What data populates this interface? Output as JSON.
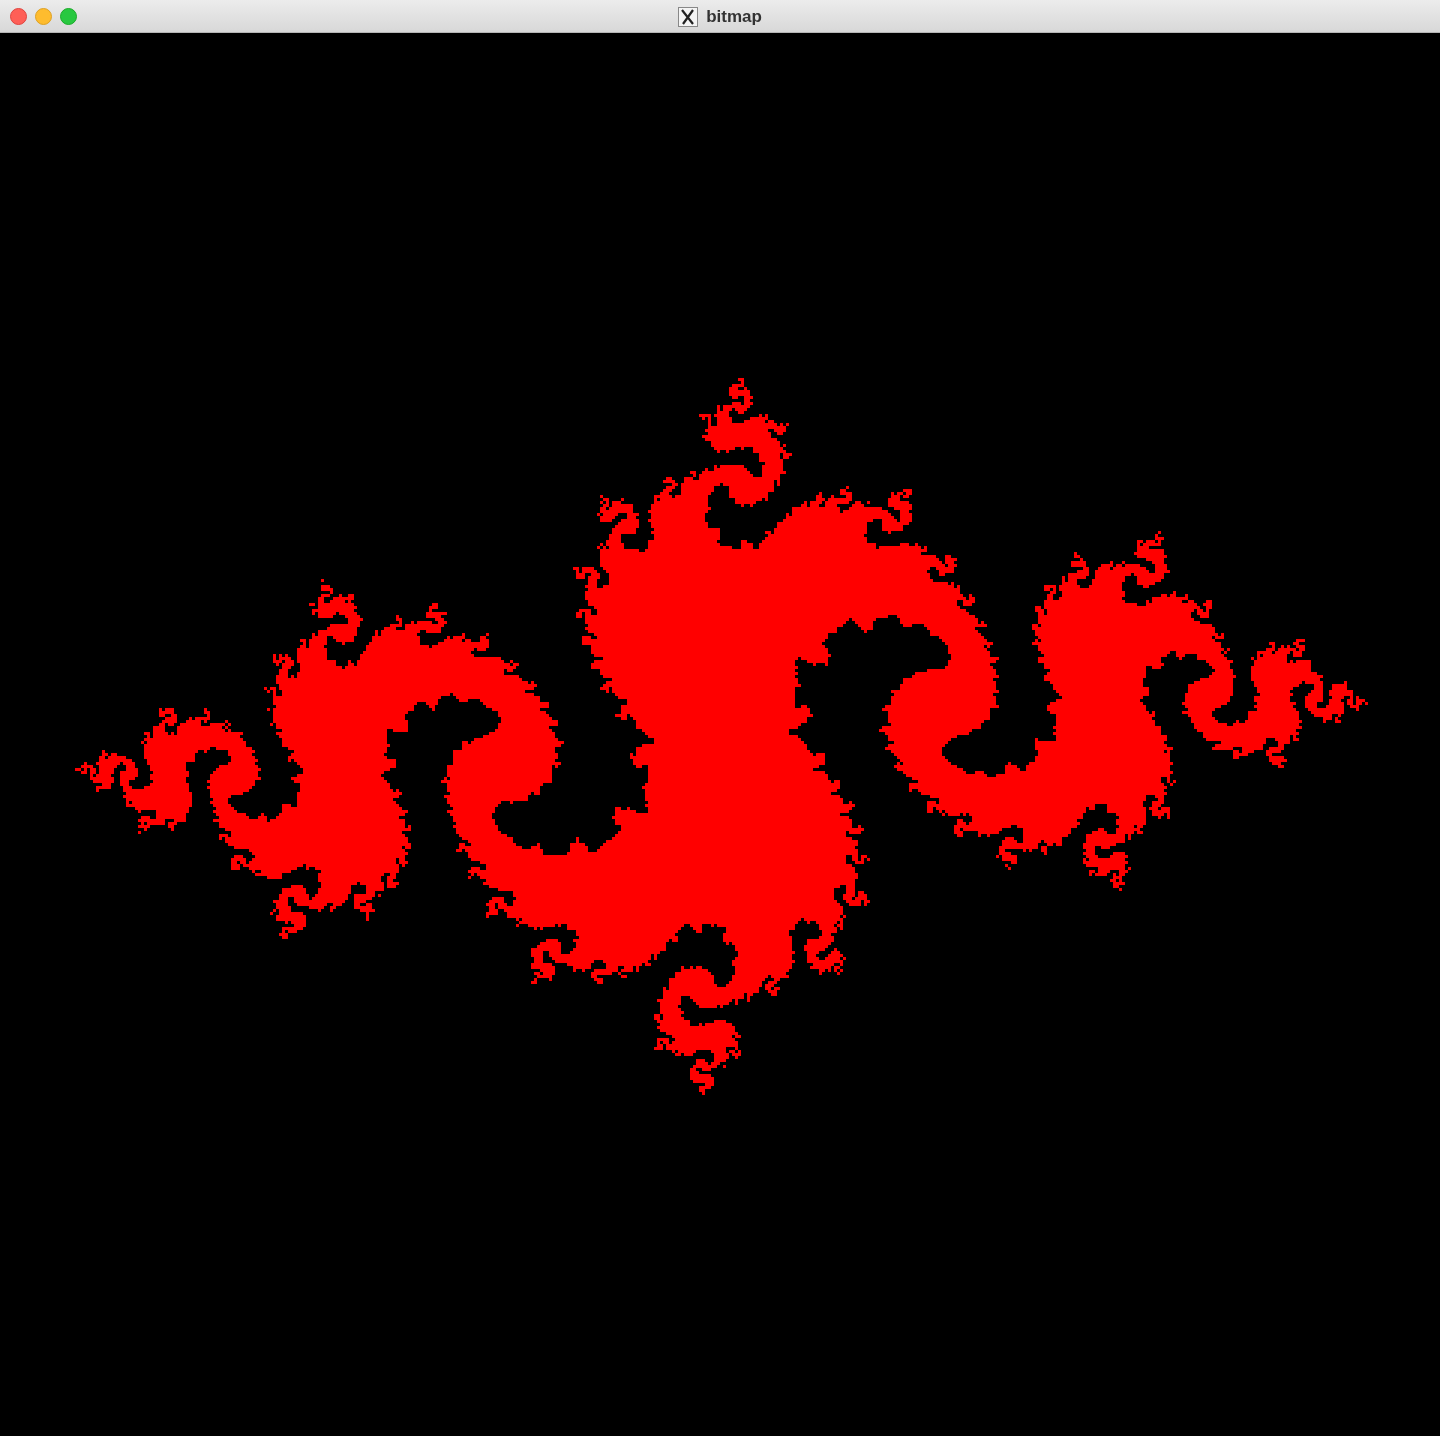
{
  "window": {
    "title": "bitmap"
  }
}
